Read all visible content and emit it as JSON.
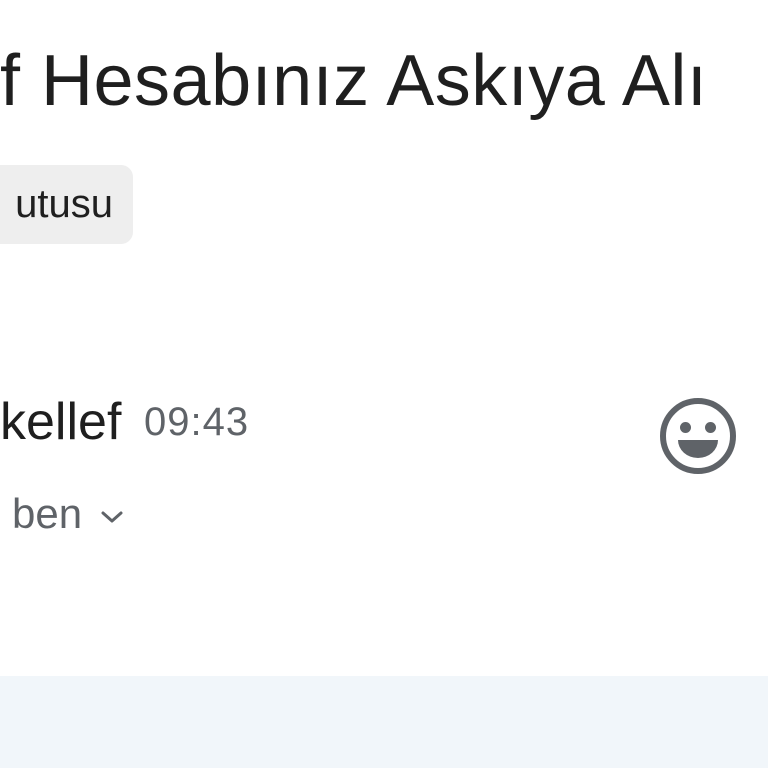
{
  "email": {
    "subject": "f Hesabınız Askıya Alı",
    "label": "utusu",
    "sender_name": "kellef",
    "time": "09:43",
    "recipient": "ben"
  },
  "icons": {
    "emoji": "smiley-face-icon",
    "recipient_details": "chevron-down-icon"
  },
  "colors": {
    "text_primary": "#1f1f1f",
    "text_secondary": "#5f6368",
    "chip_background": "#eeeeee",
    "body_background": "#f1f6fa"
  }
}
